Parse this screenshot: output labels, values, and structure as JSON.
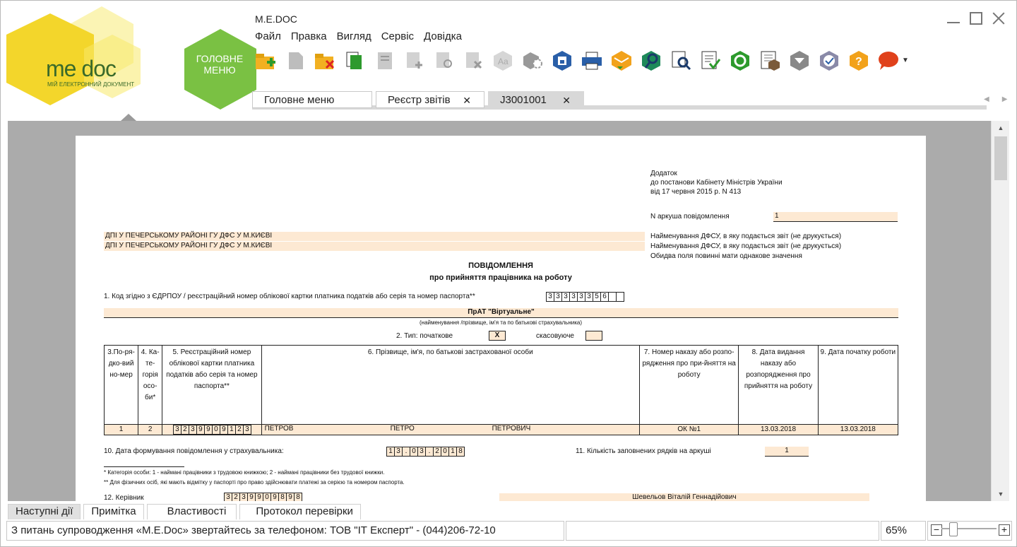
{
  "app": {
    "logo_text": "me doc",
    "logo_subtitle": "МІЙ ЕЛЕКТРОННИЙ ДОКУМЕНТ",
    "main_menu": "ГОЛОВНЕ\nМЕНЮ",
    "title": "M.E.DOC",
    "accent": "#f3d62b",
    "green": "#7ac143"
  },
  "menu": [
    "Файл",
    "Правка",
    "Вигляд",
    "Сервіс",
    "Довідка"
  ],
  "toolbar_icons": [
    "new-doc-icon",
    "copy-doc-icon",
    "delete-doc-icon",
    "green-doc-icon",
    "doc-grey-icon",
    "add-row-icon",
    "edit-row-icon",
    "remove-row-icon",
    "spellcheck-icon",
    "settings-gear-icon",
    "save-disk-icon",
    "print-icon",
    "send-envelope-icon",
    "search-hex-icon",
    "preview-search-icon",
    "checklist-icon",
    "refresh-icon",
    "calculator-icon",
    "dropdown-hex-icon",
    "verify-hex-icon",
    "help-hex-icon",
    "chat-bubble-icon"
  ],
  "tabs": [
    {
      "label": "Головне меню",
      "closable": false
    },
    {
      "label": "Реєстр звітів",
      "closable": true
    },
    {
      "label": "J3001001",
      "closable": true,
      "active": true
    }
  ],
  "doc": {
    "appendix_1": "Додаток",
    "appendix_2": "до постанови Кабінету Міністрів України",
    "appendix_3": "від 17 червня 2015 р. N 413",
    "sheet_label": "N аркуша повідомлення",
    "sheet_value": "1",
    "dfs_1": "ДПІ У ПЕЧЕРСЬКОМУ РАЙОНІ ГУ  ДФС У М.КИЄВІ",
    "dfs_2": "ДПІ У ПЕЧЕРСЬКОМУ РАЙОНІ ГУ  ДФС У М.КИЄВІ",
    "dfs_note_1": "Найменування ДФСУ, в яку подається звіт (не друкується)",
    "dfs_note_2": "Найменування ДФСУ, в яку подається звіт (не друкується)",
    "dfs_note_3": "Обидва поля повинні мати однакове значення",
    "heading_1": "ПОВІДОМЛЕННЯ",
    "heading_2": "про прийняття працівника на роботу",
    "code_label": "1.  Код згідно з ЄДРПОУ / реєстраційний номер облікової картки платника податків або серія та номер паспорта**",
    "code_cells": [
      "3",
      "3",
      "3",
      "3",
      "3",
      "3",
      "5",
      "6",
      "",
      ""
    ],
    "org_name": "ПрАТ \"Віртуальне\"",
    "org_caption": "(найменування /прізвище, ім'я та по батькові страхувальника)",
    "type_label": "2.   Тип: початкове",
    "type_initial": "X",
    "type_cancel_label": "скасовуюче",
    "table": {
      "headers": [
        "3.По-ря-дко-вий но-мер",
        "4. Ка-те-горія осо-би*",
        "5. Реєстраційний номер облікової картки платника податків або серія та номер паспорта**",
        "6. Прізвище, ім'я, по батькові застрахованої особи",
        "7. Номер наказу або розпо-рядження про при-йняття на роботу",
        "8. Дата видання наказу або розпорядження про прийняття на роботу",
        "9. Дата початку роботи"
      ],
      "row": {
        "num": "1",
        "category": "2",
        "id_cells": [
          "3",
          "2",
          "3",
          "9",
          "9",
          "0",
          "9",
          "1",
          "2",
          "3"
        ],
        "surname": "ПЕТРОВ",
        "name": "ПЕТРО",
        "patronymic": "ПЕТРОВИЧ",
        "order": "ОК №1",
        "order_date": "13.03.2018",
        "start_date": "13.03.2018"
      }
    },
    "date_label": "10.  Дата формування повідомлення у страхувальника:",
    "date_cells": [
      "1",
      "3",
      ".",
      "0",
      "3",
      ".",
      "2",
      "0",
      "1",
      "8"
    ],
    "rows_label": "11.  Кількість заповнених рядків на аркуші",
    "rows_value": "1",
    "foot_1": "* Категорія особи: 1 - наймані працівники з трудовою книжкою; 2 - наймані працівники без трудової книжки.",
    "foot_2": "** Для фізичних осіб, які мають відмітку у паспорті про право здійснювати платежі за серією та номером паспорта.",
    "head_label": "12.  Керівник",
    "head_cells": [
      "3",
      "2",
      "3",
      "9",
      "9",
      "0",
      "9",
      "8",
      "9",
      "8"
    ],
    "head_name": "Шевельов Віталій Геннадійович"
  },
  "bottom_tabs": [
    "Наступні дії",
    "Примітка",
    "Властивості",
    "Протокол перевірки"
  ],
  "status": {
    "message": "З питань супроводження «M.E.Doc» звертайтесь за телефоном: ТОВ \"ІТ Експерт\" - (044)206-72-10",
    "zoom": "65%",
    "zoom_minus": "−",
    "zoom_plus": "+"
  }
}
